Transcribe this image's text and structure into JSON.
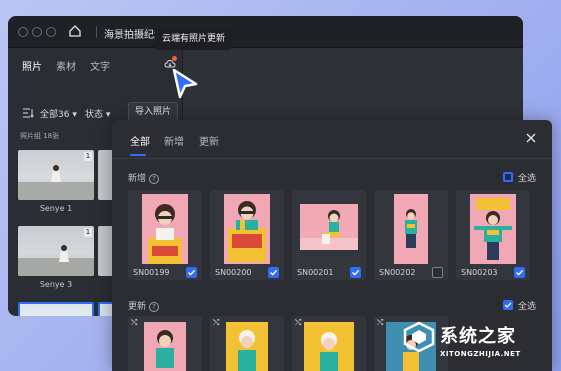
{
  "app": {
    "title": "海景拍摄纪念",
    "sidebar": {
      "tabs": [
        {
          "label": "照片",
          "active": true
        },
        {
          "label": "素材",
          "active": false
        },
        {
          "label": "文字",
          "active": false
        }
      ],
      "filter_all": "全部36",
      "filter_status": "状态",
      "import_button": "导入照片",
      "group_label": "照片组 18张",
      "thumbnails": [
        {
          "caption": "Senye 1",
          "count": "1"
        },
        {
          "caption": "Senye 3",
          "count": "1"
        },
        {
          "caption": "",
          "count": "1"
        },
        {
          "caption": "",
          "count": "1"
        }
      ]
    }
  },
  "tooltip": "云端有照片更新",
  "dialog": {
    "tabs": [
      {
        "label": "全部",
        "active": true
      },
      {
        "label": "新增",
        "active": false
      },
      {
        "label": "更新",
        "active": false
      }
    ],
    "new_section": {
      "label": "新增",
      "select_all": "全选",
      "items": [
        {
          "code": "SN00199",
          "checked": true
        },
        {
          "code": "SN00200",
          "checked": true
        },
        {
          "code": "SN00201",
          "checked": true
        },
        {
          "code": "SN00202",
          "checked": false
        },
        {
          "code": "SN00203",
          "checked": true
        }
      ]
    },
    "update_section": {
      "label": "更新",
      "select_all": "全选",
      "swap_icon": "⤭"
    }
  },
  "watermark": {
    "text": "系统之家",
    "url": "XITONGZHIJIA.NET"
  },
  "colors": {
    "accent": "#2f6df6",
    "badge": "#ff5a3c",
    "window_bg": "#2b2d34"
  }
}
